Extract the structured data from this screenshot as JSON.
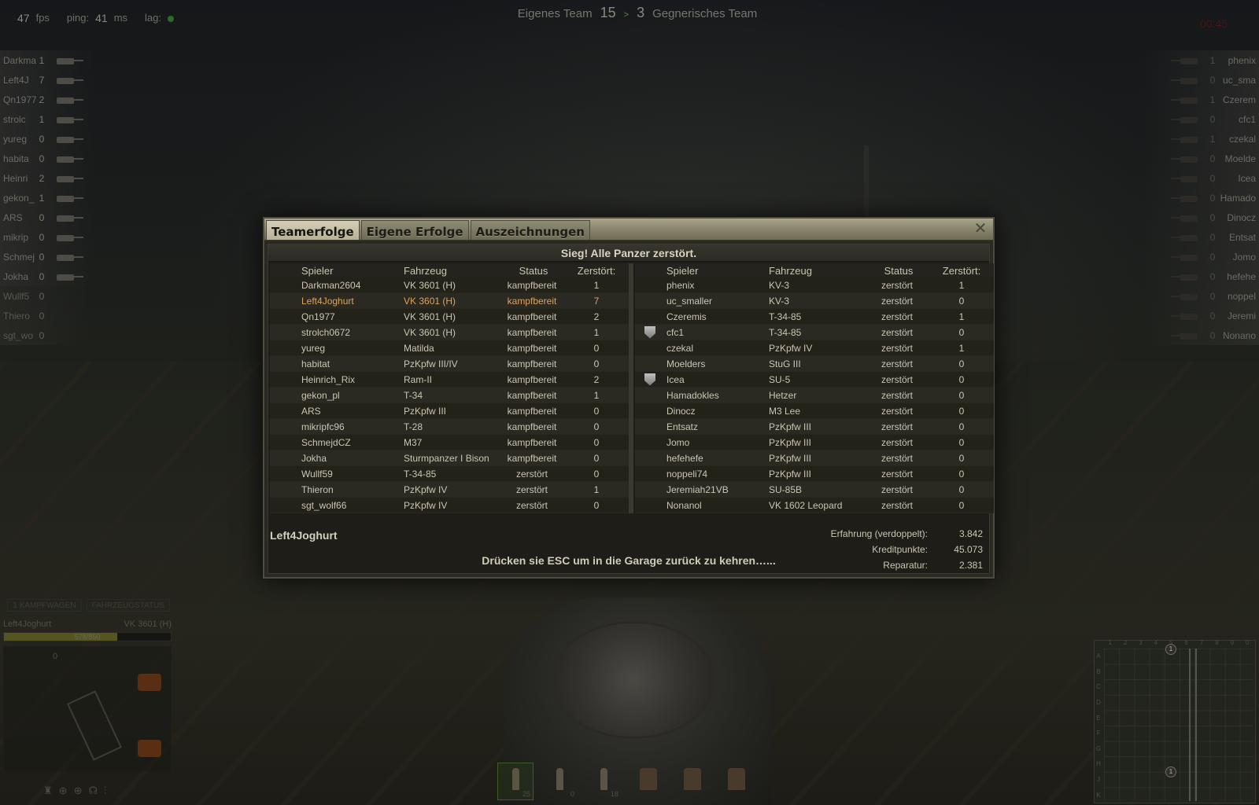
{
  "hud": {
    "fps_value": "47",
    "fps_label": "fps",
    "ping_label": "ping:",
    "ping_value": "41",
    "ping_unit": "ms",
    "lag_label": "lag:",
    "own_team_label": "Eigenes Team",
    "own_score": "15",
    "score_sep": ">",
    "enemy_score": "3",
    "enemy_team_label": "Gegnerisches Team",
    "timer": "00:45"
  },
  "left_list": [
    {
      "name": "Darkma",
      "frags": "1",
      "alive": true
    },
    {
      "name": "Left4J",
      "frags": "7",
      "alive": true
    },
    {
      "name": "Qn1977",
      "frags": "2",
      "alive": true
    },
    {
      "name": "strolc",
      "frags": "1",
      "alive": true
    },
    {
      "name": "yureg",
      "frags": "0",
      "alive": true
    },
    {
      "name": "habita",
      "frags": "0",
      "alive": true
    },
    {
      "name": "Heinri",
      "frags": "2",
      "alive": true
    },
    {
      "name": "gekon_",
      "frags": "1",
      "alive": true
    },
    {
      "name": "ARS",
      "frags": "0",
      "alive": true
    },
    {
      "name": "mikrip",
      "frags": "0",
      "alive": true
    },
    {
      "name": "Schmej",
      "frags": "0",
      "alive": true
    },
    {
      "name": "Jokha",
      "frags": "0",
      "alive": true
    },
    {
      "name": "Wullf5",
      "frags": "0",
      "alive": false
    },
    {
      "name": "Thiero",
      "frags": "0",
      "alive": false
    },
    {
      "name": "sgt_wo",
      "frags": "0",
      "alive": false
    }
  ],
  "right_list": [
    {
      "name": "phenix",
      "frags": "1"
    },
    {
      "name": "uc_sma",
      "frags": "0"
    },
    {
      "name": "Czerem",
      "frags": "1"
    },
    {
      "name": "cfc1",
      "frags": "0"
    },
    {
      "name": "czekal",
      "frags": "1"
    },
    {
      "name": "Moelde",
      "frags": "0"
    },
    {
      "name": "Icea",
      "frags": "0"
    },
    {
      "name": "Hamado",
      "frags": "0"
    },
    {
      "name": "Dinocz",
      "frags": "0"
    },
    {
      "name": "Entsat",
      "frags": "0"
    },
    {
      "name": "Jomo",
      "frags": "0"
    },
    {
      "name": "hefehe",
      "frags": "0"
    },
    {
      "name": "noppel",
      "frags": "0"
    },
    {
      "name": "Jeremi",
      "frags": "0"
    },
    {
      "name": "Nonano",
      "frags": "0"
    }
  ],
  "dialog": {
    "tabs": [
      "Teamerfolge",
      "Eigene Erfolge",
      "Auszeichnungen"
    ],
    "close_glyph": "✕",
    "result_title": "Sieg! Alle Panzer zerstört.",
    "columns": {
      "player": "Spieler",
      "vehicle": "Fahrzeug",
      "status": "Status",
      "destroyed": "Zerstört:"
    },
    "own_team": [
      {
        "player": "Darkman2604",
        "vehicle": "VK 3601 (H)",
        "status": "kampfbereit",
        "kills": "1"
      },
      {
        "player": "Left4Joghurt",
        "vehicle": "VK 3601 (H)",
        "status": "kampfbereit",
        "kills": "7",
        "self": true
      },
      {
        "player": "Qn1977",
        "vehicle": "VK 3601 (H)",
        "status": "kampfbereit",
        "kills": "2"
      },
      {
        "player": "strolch0672",
        "vehicle": "VK 3601 (H)",
        "status": "kampfbereit",
        "kills": "1"
      },
      {
        "player": "yureg",
        "vehicle": "Matilda",
        "status": "kampfbereit",
        "kills": "0"
      },
      {
        "player": "habitat",
        "vehicle": "PzKpfw III/IV",
        "status": "kampfbereit",
        "kills": "0"
      },
      {
        "player": "Heinrich_Rix",
        "vehicle": "Ram-II",
        "status": "kampfbereit",
        "kills": "2"
      },
      {
        "player": "gekon_pl",
        "vehicle": "T-34",
        "status": "kampfbereit",
        "kills": "1"
      },
      {
        "player": "ARS",
        "vehicle": "PzKpfw III",
        "status": "kampfbereit",
        "kills": "0"
      },
      {
        "player": "mikripfc96",
        "vehicle": "T-28",
        "status": "kampfbereit",
        "kills": "0"
      },
      {
        "player": "SchmejdCZ",
        "vehicle": "M37",
        "status": "kampfbereit",
        "kills": "0"
      },
      {
        "player": "Jokha",
        "vehicle": "Sturmpanzer I Bison",
        "status": "kampfbereit",
        "kills": "0"
      },
      {
        "player": "Wullf59",
        "vehicle": "T-34-85",
        "status": "zerstört",
        "kills": "0"
      },
      {
        "player": "Thieron",
        "vehicle": "PzKpfw IV",
        "status": "zerstört",
        "kills": "1"
      },
      {
        "player": "sgt_wolf66",
        "vehicle": "PzKpfw IV",
        "status": "zerstört",
        "kills": "0"
      }
    ],
    "enemy_team": [
      {
        "player": "phenix",
        "vehicle": "KV-3",
        "status": "zerstört",
        "kills": "1"
      },
      {
        "player": "uc_smaller",
        "vehicle": "KV-3",
        "status": "zerstört",
        "kills": "0"
      },
      {
        "player": "Czeremis",
        "vehicle": "T-34-85",
        "status": "zerstört",
        "kills": "1"
      },
      {
        "player": "cfc1",
        "vehicle": "T-34-85",
        "status": "zerstört",
        "kills": "0",
        "badge": true
      },
      {
        "player": "czekal",
        "vehicle": "PzKpfw IV",
        "status": "zerstört",
        "kills": "1"
      },
      {
        "player": "Moelders",
        "vehicle": "StuG III",
        "status": "zerstört",
        "kills": "0"
      },
      {
        "player": "Icea",
        "vehicle": "SU-5",
        "status": "zerstört",
        "kills": "0",
        "badge": true
      },
      {
        "player": "Hamadokles",
        "vehicle": "Hetzer",
        "status": "zerstört",
        "kills": "0"
      },
      {
        "player": "Dinocz",
        "vehicle": "M3 Lee",
        "status": "zerstört",
        "kills": "0"
      },
      {
        "player": "Entsatz",
        "vehicle": "PzKpfw III",
        "status": "zerstört",
        "kills": "0"
      },
      {
        "player": "Jomo",
        "vehicle": "PzKpfw III",
        "status": "zerstört",
        "kills": "0"
      },
      {
        "player": "hefehefe",
        "vehicle": "PzKpfw III",
        "status": "zerstört",
        "kills": "0"
      },
      {
        "player": "noppeli74",
        "vehicle": "PzKpfw III",
        "status": "zerstört",
        "kills": "0"
      },
      {
        "player": "Jeremiah21VB",
        "vehicle": "SU-85B",
        "status": "zerstört",
        "kills": "0"
      },
      {
        "player": "Nonanol",
        "vehicle": "VK 1602 Leopard",
        "status": "zerstört",
        "kills": "0"
      }
    ],
    "summary": {
      "player_name": "Left4Joghurt",
      "esc_hint": "Drücken sie ESC um in die Garage zurück zu kehren…...",
      "exp_label": "Erfahrung (verdoppelt):",
      "exp_value": "3.842",
      "credits_label": "Kreditpunkte:",
      "credits_value": "45.073",
      "repair_label": "Reparatur:",
      "repair_value": "2.381"
    }
  },
  "damage_panel": {
    "tab1": "1 KAMPFWAGEN",
    "tab2": "FAHRZEUGSTATUS",
    "player": "Left4Joghurt",
    "vehicle": "VK 3601 (H)",
    "hp_text": "578/850",
    "hp_fraction": 0.68,
    "speed": "0"
  },
  "ammo": [
    {
      "count": "25",
      "selected": true
    },
    {
      "count": "0",
      "selected": false
    },
    {
      "count": "18",
      "selected": false
    }
  ],
  "minimap": {
    "cols": [
      "1",
      "2",
      "3",
      "4",
      "5",
      "6",
      "7",
      "8",
      "9",
      "0"
    ],
    "rows": [
      "A",
      "B",
      "C",
      "D",
      "E",
      "F",
      "G",
      "H",
      "J",
      "K"
    ],
    "base_top": "1",
    "base_bottom": "1"
  },
  "colors": {
    "self_highlight": "#e0a25a",
    "tab_active": "#d4cfb4",
    "hp_fill": "#55561f"
  }
}
